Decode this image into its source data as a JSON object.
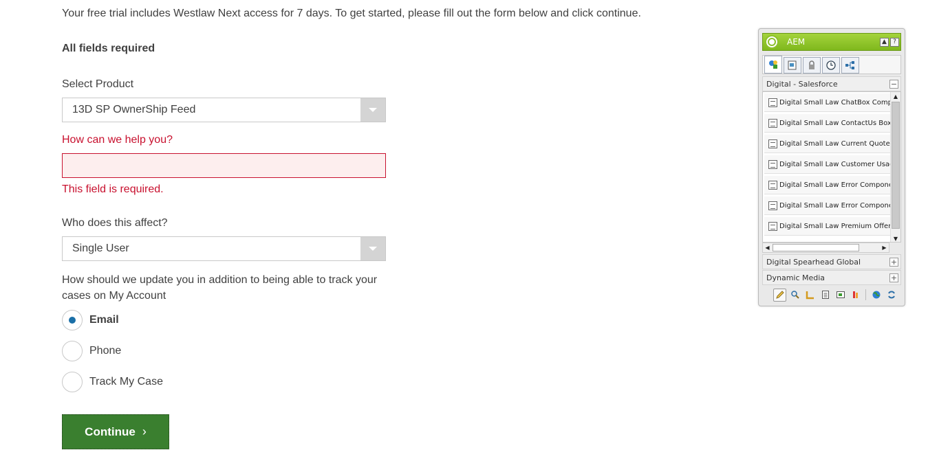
{
  "form": {
    "intro": "Your free trial includes Westlaw Next access for 7 days. To get started, please fill out the form below and click continue.",
    "required_note": "All fields required",
    "product_label": "Select Product",
    "product_value": "13D SP OwnerShip Feed",
    "help_label": "How can we help you?",
    "help_value": "",
    "help_error": "This field is required.",
    "affect_label": "Who does this affect?",
    "affect_value": "Single User",
    "update_question": "How should we update you in addition to being able to track your cases on My Account",
    "options": [
      {
        "label": "Email",
        "checked": true
      },
      {
        "label": "Phone",
        "checked": false
      },
      {
        "label": "Track My Case",
        "checked": false
      }
    ],
    "continue_label": "Continue",
    "continue_icon": "chevron-right-icon",
    "error_color": "#c8102e",
    "button_color": "#3a7f2f"
  },
  "aem": {
    "title": "AEM",
    "header_buttons": [
      "▲",
      "?"
    ],
    "tabs": [
      "components-icon",
      "assets-icon",
      "lock-icon",
      "clock-icon",
      "workflow-icon"
    ],
    "group_active": "Digital - Salesforce",
    "items": [
      "Digital Small Law ChatBox Compo",
      "Digital Small Law ContactUs Box",
      "Digital Small Law Current Quote",
      "Digital Small Law Customer Usage",
      "Digital Small Law Error Componen",
      "Digital Small Law Error Componen",
      "Digital Small Law Premium Offer"
    ],
    "groups_collapsed": [
      "Digital Spearhead Global",
      "Dynamic Media"
    ],
    "toolbar": [
      "edit-icon",
      "search-icon",
      "ruler-icon",
      "page-icon",
      "screenshot-icon",
      "flag-icon",
      "globe-icon",
      "refresh-icon"
    ],
    "accent_color": "#8dc12a"
  }
}
